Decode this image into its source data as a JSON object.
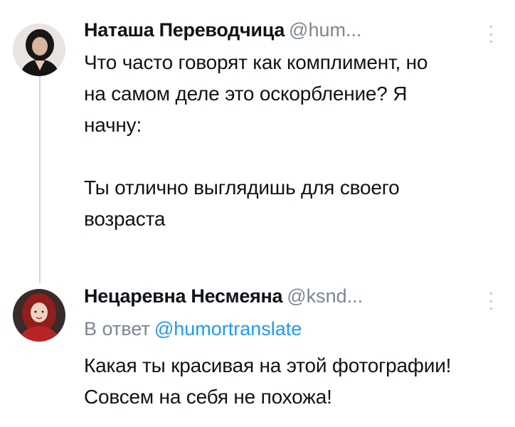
{
  "tweets": [
    {
      "author_name": "Наташа Переводчица",
      "handle": "@hum...",
      "text_lines": [
        "Что часто говорят как комплимент, но",
        "на самом деле это оскорбление? Я",
        "начну:"
      ],
      "text_lines_2": [
        "Ты отлично выглядишь для своего",
        "возраста"
      ],
      "avatar_icon": "woman-dark-hair-avatar",
      "more_icon": "vertical-ellipsis-icon"
    },
    {
      "author_name": "Нецаревна Несмеяна",
      "handle": "@ksnd...",
      "reply_prefix": "В ответ",
      "reply_to": "@humortranslate",
      "text_lines": [
        "Какая ты красивая на этой фотографии!",
        "Совсем на себя не похожа!"
      ],
      "avatar_icon": "woman-red-hair-avatar",
      "more_icon": "vertical-ellipsis-icon"
    }
  ],
  "colors": {
    "text": "#0f1419",
    "secondary": "#7b8791",
    "link": "#1d9bf0",
    "thread_line": "#cfd9de"
  }
}
